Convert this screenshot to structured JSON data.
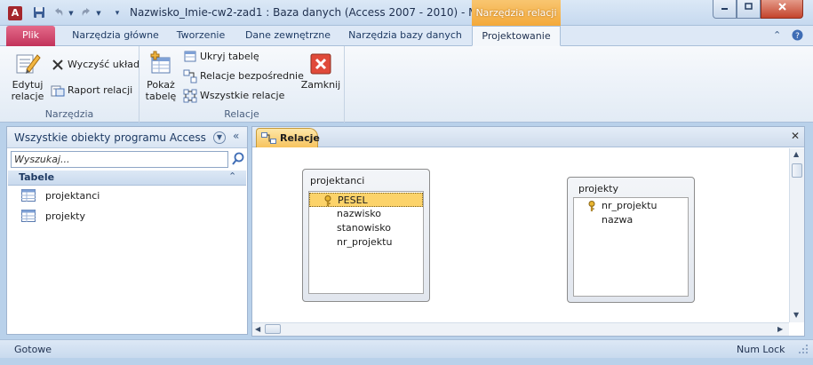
{
  "window": {
    "title": "Nazwisko_Imie-cw2-zad1 : Baza danych (Access 2007 - 2010)  -  Micr...",
    "context_tab_title": "Narzędzia relacji",
    "app_icon_letter": "A",
    "minimize": "▭",
    "maximize": "□",
    "close": "✕"
  },
  "qat": {
    "save": "save-icon",
    "undo": "undo-icon",
    "redo": "redo-icon",
    "customize": "customize-icon"
  },
  "ribbon_tabs": [
    {
      "label": "Plik"
    },
    {
      "label": "Narzędzia główne"
    },
    {
      "label": "Tworzenie"
    },
    {
      "label": "Dane zewnętrzne"
    },
    {
      "label": "Narzędzia bazy danych"
    },
    {
      "label": "Projektowanie"
    }
  ],
  "ribbon": {
    "groups": [
      {
        "label": "Narzędzia",
        "big": {
          "label_line1": "Edytuj",
          "label_line2": "relacje"
        },
        "small": [
          {
            "label": "Wyczyść układ"
          },
          {
            "label": "Raport relacji"
          }
        ]
      },
      {
        "label": "Relacje",
        "big": {
          "label_line1": "Pokaż",
          "label_line2": "tabelę"
        },
        "small": [
          {
            "label": "Ukryj tabelę"
          },
          {
            "label": "Relacje bezpośrednie"
          },
          {
            "label": "Wszystkie relacje"
          }
        ],
        "close": {
          "label": "Zamknij"
        }
      }
    ]
  },
  "navigation": {
    "title": "Wszystkie obiekty programu Access",
    "search_placeholder": "Wyszukaj...",
    "section": "Tabele",
    "items": [
      {
        "label": "projektanci"
      },
      {
        "label": "projekty"
      }
    ]
  },
  "document": {
    "tab_label": "Relacje",
    "tables": [
      {
        "name": "projektanci",
        "fields": [
          {
            "name": "PESEL",
            "key": true,
            "selected": true
          },
          {
            "name": "nazwisko",
            "key": false,
            "selected": false
          },
          {
            "name": "stanowisko",
            "key": false,
            "selected": false
          },
          {
            "name": "nr_projektu",
            "key": false,
            "selected": false
          }
        ]
      },
      {
        "name": "projekty",
        "fields": [
          {
            "name": "nr_projektu",
            "key": true,
            "selected": false
          },
          {
            "name": "nazwa",
            "key": false,
            "selected": false
          }
        ]
      }
    ]
  },
  "status": {
    "left": "Gotowe",
    "right": "Num Lock"
  },
  "colors": {
    "file_tab": "#c2335a",
    "context_tab": "#f3a93a",
    "selected_field": "#fcd36a"
  }
}
